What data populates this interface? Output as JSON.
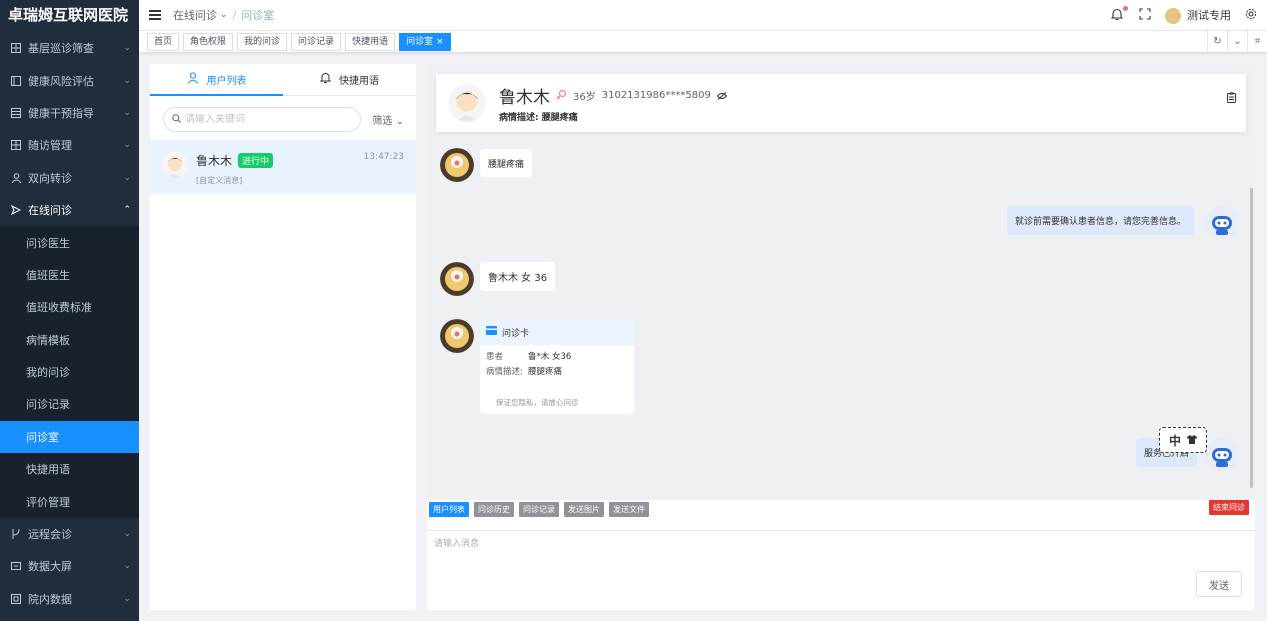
{
  "app": {
    "title": "卓瑞姆互联网医院"
  },
  "sidebar": {
    "items": [
      {
        "label": "基层巡诊筛查",
        "icon": "grid-icon"
      },
      {
        "label": "健康风险评估",
        "icon": "doc-icon"
      },
      {
        "label": "健康干预指导",
        "icon": "table-icon"
      },
      {
        "label": "随访管理",
        "icon": "grid-icon"
      },
      {
        "label": "双向转诊",
        "icon": "people-icon"
      },
      {
        "label": "在线问诊",
        "icon": "send-icon"
      }
    ],
    "submenu": [
      {
        "label": "问诊医生"
      },
      {
        "label": "值班医生"
      },
      {
        "label": "值班收费标准"
      },
      {
        "label": "病情模板"
      },
      {
        "label": "我的问诊"
      },
      {
        "label": "问诊记录"
      },
      {
        "label": "问诊室"
      },
      {
        "label": "快捷用语"
      },
      {
        "label": "评价管理"
      }
    ],
    "bottom": [
      {
        "label": "远程会诊"
      },
      {
        "label": "数据大屏"
      },
      {
        "label": "院内数据"
      }
    ]
  },
  "header": {
    "breadcrumb": [
      "在线问诊",
      "问诊室"
    ],
    "user_name": "测试专用"
  },
  "tabs": [
    "首页",
    "角色权限",
    "我的问诊",
    "问诊记录",
    "快捷用语",
    "问诊室"
  ],
  "left_panel": {
    "tab_users": "用户列表",
    "tab_phrases": "快捷用语",
    "search_placeholder": "请输入关键词",
    "filter_label": "筛选",
    "conversation": {
      "name": "鲁木木",
      "status": "进行中",
      "time": "13:47:23",
      "subtitle": "[自定义消息]"
    }
  },
  "patient": {
    "name": "鲁木木",
    "age": "36岁",
    "id_number": "3102131986****5809",
    "desc_label": "病情描述:",
    "desc_value": "腰腿疼痛"
  },
  "messages": {
    "m1": "腰腿疼痛",
    "m2": "就诊前需要确认患者信息，请您完善信息。",
    "m3": "鲁木木 女 36",
    "card_title": "问诊卡",
    "card_patient_label": "患者",
    "card_patient_value": "鲁*木 女36",
    "card_desc_label": "病情描述:",
    "card_desc_value": "腰腿疼痛",
    "card_footer": "保证您隐私，请放心问诊",
    "m4": "服务已开启",
    "ime": "中"
  },
  "toolbar": [
    "用户列表",
    "问诊历史",
    "问诊记录",
    "发送图片",
    "发送文件"
  ],
  "end_button": "结束问诊",
  "input_placeholder": "请输入消息",
  "send_button": "发送",
  "colors": {
    "primary": "#1890ff",
    "sidebar_bg": "#1f2d3d",
    "danger": "#e6372f",
    "success": "#13ce66"
  }
}
